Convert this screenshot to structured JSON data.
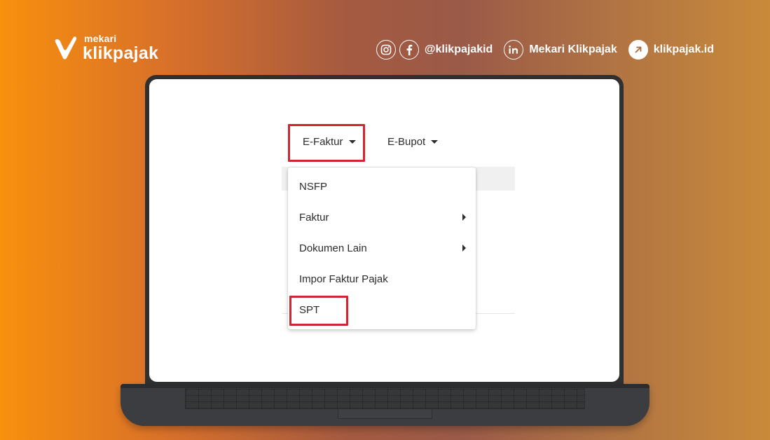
{
  "brand": {
    "sub": "mekari",
    "name": "klikpajak"
  },
  "socials": {
    "handle": "@klikpajakid",
    "linkedin": "Mekari Klikpajak",
    "website": "klikpajak.id"
  },
  "nav": {
    "items": [
      {
        "label": "E-Faktur",
        "highlighted": true
      },
      {
        "label": "E-Bupot",
        "highlighted": false
      }
    ]
  },
  "dropdown": {
    "items": [
      {
        "label": "NSFP",
        "has_submenu": false
      },
      {
        "label": "Faktur",
        "has_submenu": true
      },
      {
        "label": "Dokumen Lain",
        "has_submenu": true
      },
      {
        "label": "Impor Faktur Pajak",
        "has_submenu": false
      },
      {
        "label": "SPT",
        "has_submenu": false,
        "highlighted": true
      }
    ]
  },
  "colors": {
    "highlight": "#d32530",
    "brand_orange": "#f8900d"
  }
}
